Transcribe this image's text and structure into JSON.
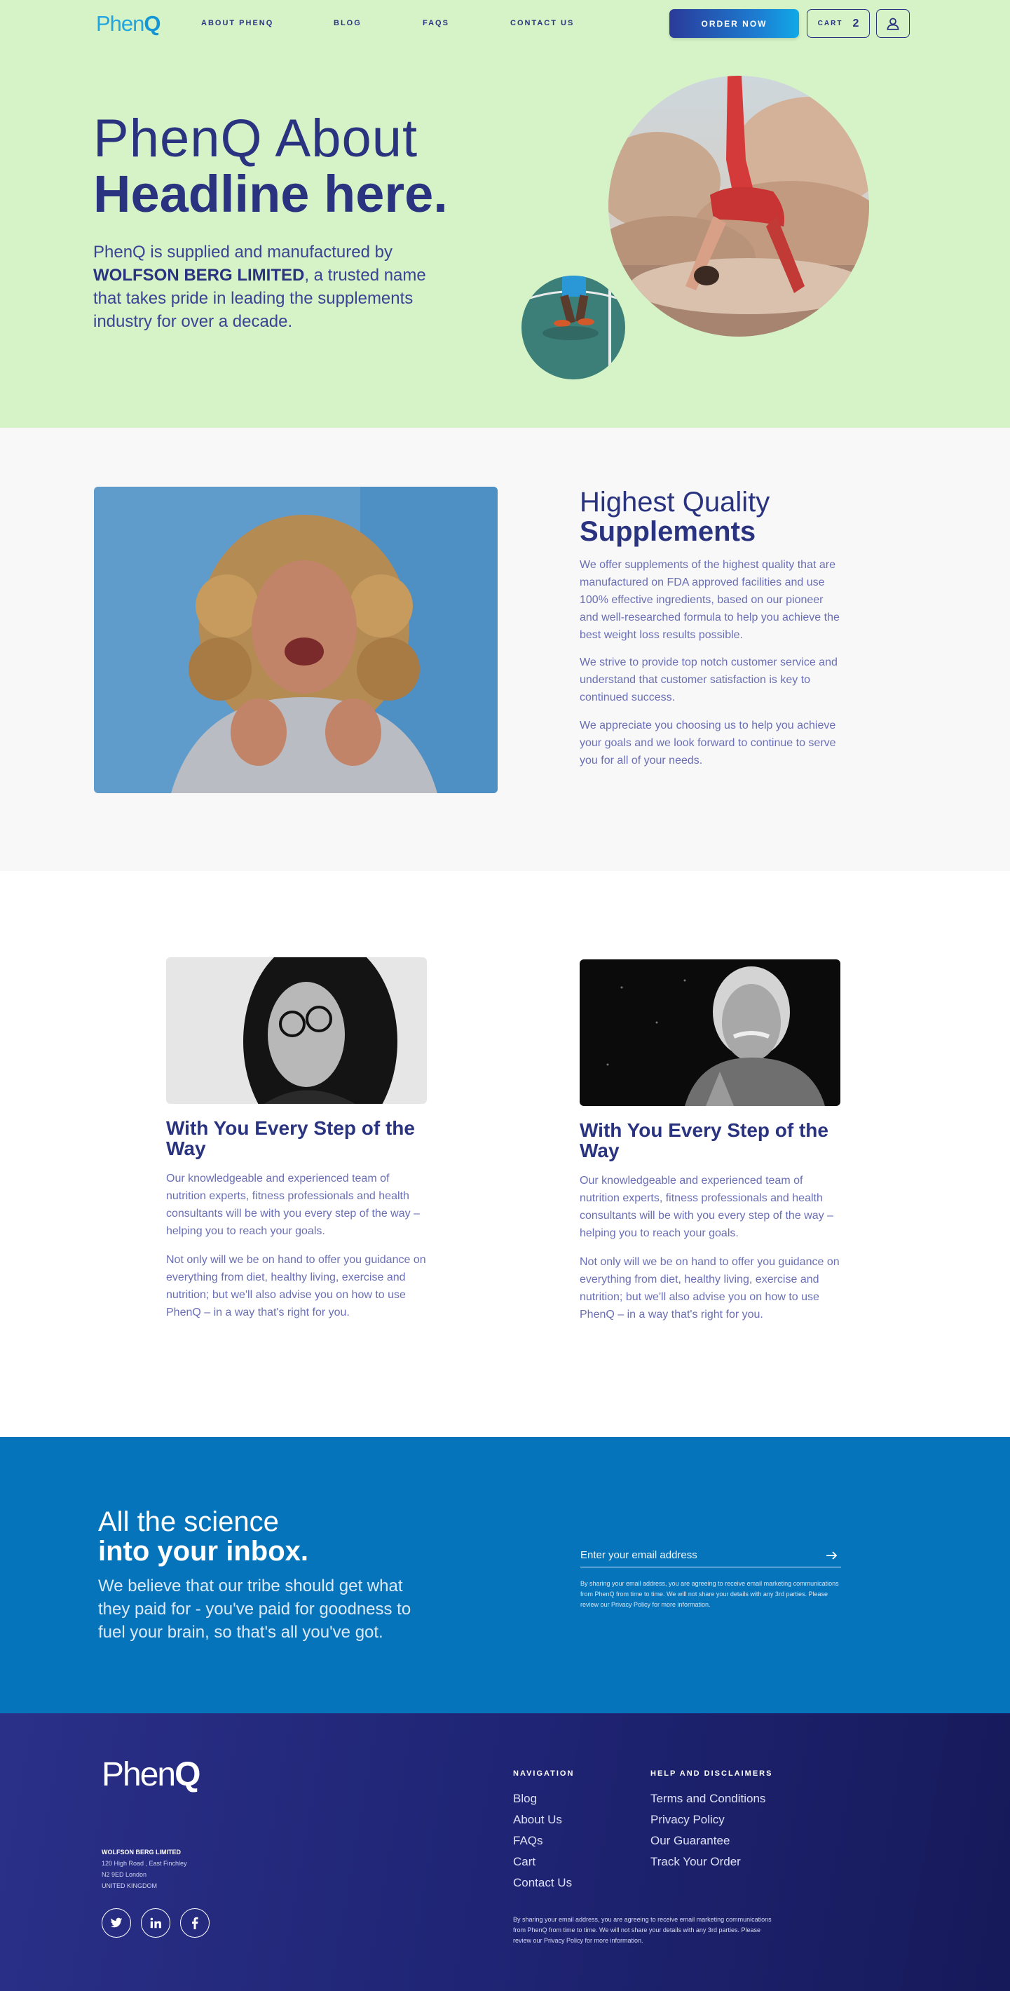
{
  "header": {
    "logo": {
      "light": "Phen",
      "bold": "Q"
    },
    "nav": [
      "ABOUT PHENQ",
      "BLOG",
      "FAQS",
      "CONTACT US"
    ],
    "order_label": "ORDER NOW",
    "cart_label": "CART",
    "cart_count": "2",
    "user_icon": "user-icon"
  },
  "hero": {
    "title_light": "PhenQ About",
    "title_bold": "Headline here.",
    "text_before": "PhenQ is supplied and manufactured by",
    "text_company": "WOLFSON BERG LIMITED",
    "text_after": ", a trusted name that takes pride in leading the supplements industry for over a decade."
  },
  "quality": {
    "title_light": "Highest Quality",
    "title_bold": "Supplements",
    "paragraphs": [
      "We offer supplements of the highest quality that are manufactured on FDA approved facilities and use 100% effective ingredients, based on our pioneer and well-researched formula to help you achieve the best weight loss results possible.",
      "We strive to provide top notch customer service and understand that customer satisfaction is key to continued success.",
      "We appreciate you choosing us to help you achieve your goals and we look forward to continue to serve you for all of your needs."
    ]
  },
  "cards": [
    {
      "title": "With You Every Step of the Way",
      "p1": "Our knowledgeable and experienced team of nutrition experts, fitness professionals and health consultants will be with you every step of the way – helping you to reach your goals.",
      "p2": "Not only will we be on hand to offer you guidance on everything from diet, healthy living, exercise and nutrition; but we'll also advise you on how to use PhenQ – in a way that's right for you."
    },
    {
      "title": "With You Every Step of the Way",
      "p1": "Our knowledgeable and experienced team of nutrition experts, fitness professionals and health consultants will be with you every step of the way – helping you to reach your goals.",
      "p2": "Not only will we be on hand to offer you guidance on everything from diet, healthy living, exercise and nutrition; but we'll also advise you on how to use PhenQ – in a way that's right for you."
    }
  ],
  "newsletter": {
    "title_light": "All the science",
    "title_bold": "into your inbox.",
    "text": "We believe that our tribe should get what they paid for - you've paid for goodness to fuel your brain, so that's all you've got.",
    "email_placeholder": "Enter your email address",
    "fine_print": "By sharing your email address, you are agreeing to receive email marketing communications from PhenQ from time to time. We will not share your details with any 3rd parties. Please review our Privacy Policy for more information."
  },
  "footer": {
    "logo": {
      "light": "Phen",
      "bold": "Q"
    },
    "company": "WOLFSON BERG LIMITED",
    "address": [
      "120 High Road , East Finchley",
      "N2 9ED London",
      "UNITED KINGDOM"
    ],
    "nav_heading": "NAVIGATION",
    "nav_links": [
      "Blog",
      "About Us",
      "FAQs",
      "Cart",
      "Contact Us"
    ],
    "help_heading": "HELP AND DISCLAIMERS",
    "help_links": [
      "Terms and Conditions",
      "Privacy Policy",
      "Our Guarantee",
      "Track Your Order"
    ],
    "social": [
      "twitter-icon",
      "linkedin-icon",
      "facebook-icon"
    ],
    "fine_print": "By sharing your email address, you are agreeing to receive email marketing communications from PhenQ from time to time. We will not share your details with any 3rd parties. Please review our Privacy Policy for more information."
  },
  "colors": {
    "hero_bg": "#d5f3c6",
    "navy": "#2a3380",
    "brand_blue": "#0574ba",
    "footer_bg": "#1f2474"
  }
}
